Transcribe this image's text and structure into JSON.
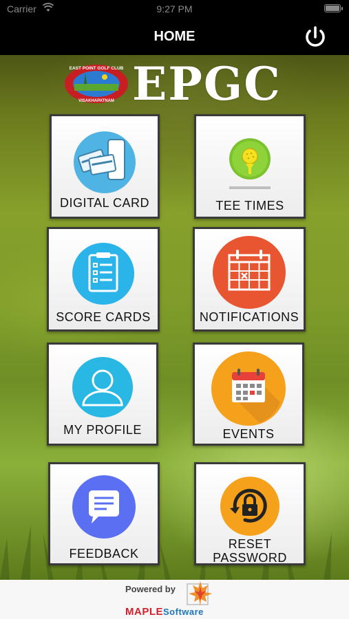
{
  "status": {
    "carrier": "Carrier",
    "time": "9:27 PM"
  },
  "navbar": {
    "title": "HOME",
    "power_icon": "power-icon"
  },
  "header": {
    "logo_ring_top": "EAST POINT GOLF CLUB",
    "logo_ring_bottom": "VISAKHAPATNAM",
    "brand": "EPGC"
  },
  "tiles": [
    {
      "label": "DIGITAL CARD",
      "icon": "digital-card-icon",
      "color": "#4fb3e3"
    },
    {
      "label": "TEE TIMES",
      "icon": "golf-ball-tee-icon",
      "color": "#7cc22e"
    },
    {
      "label": "SCORE CARDS",
      "icon": "clipboard-icon",
      "color": "#2bb4ea"
    },
    {
      "label": "NOTIFICATIONS",
      "icon": "calendar-icon",
      "color": "#e85531"
    },
    {
      "label": "MY PROFILE",
      "icon": "user-icon",
      "color": "#29b7e4"
    },
    {
      "label": "EVENTS",
      "icon": "calendar-events-icon",
      "color": "#f5a11c"
    },
    {
      "label": "FEEDBACK",
      "icon": "chat-icon",
      "color": "#5a6ff2"
    },
    {
      "label_line1": "RESET",
      "label_line2": "PASSWORD",
      "icon": "lock-reset-icon",
      "color": "#f5a11c"
    }
  ],
  "footer": {
    "powered_by": "Powered by",
    "brand_maple": "MAPLE",
    "brand_software": "Software"
  }
}
